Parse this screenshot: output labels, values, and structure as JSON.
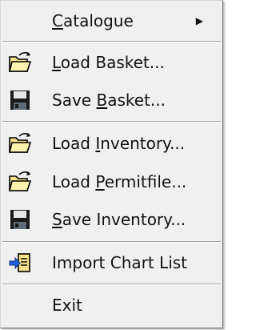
{
  "menu": {
    "catalogue": {
      "pre": "",
      "u": "C",
      "post": "atalogue",
      "submenu_arrow": "▶"
    },
    "load_basket": {
      "pre": "",
      "u": "L",
      "post": "oad Basket...",
      "icon": "open-folder-icon"
    },
    "save_basket": {
      "pre": "Save ",
      "u": "B",
      "post": "asket...",
      "icon": "floppy-disk-icon"
    },
    "load_inventory": {
      "pre": "Load ",
      "u": "I",
      "post": "nventory...",
      "icon": "open-folder-icon"
    },
    "load_permitfile": {
      "pre": "Load ",
      "u": "P",
      "post": "ermitfile...",
      "icon": "open-folder-icon"
    },
    "save_inventory": {
      "pre": "",
      "u": "S",
      "post": "ave Inventory...",
      "icon": "floppy-disk-icon"
    },
    "import_chart_list": {
      "pre": "Import Chart List",
      "u": "",
      "post": "",
      "icon": "import-icon"
    },
    "exit": {
      "pre": "Exit",
      "u": "",
      "post": ""
    }
  },
  "colors": {
    "menu_background": "#f0f0f0",
    "separator": "#a0a0a0",
    "text": "#111111"
  }
}
